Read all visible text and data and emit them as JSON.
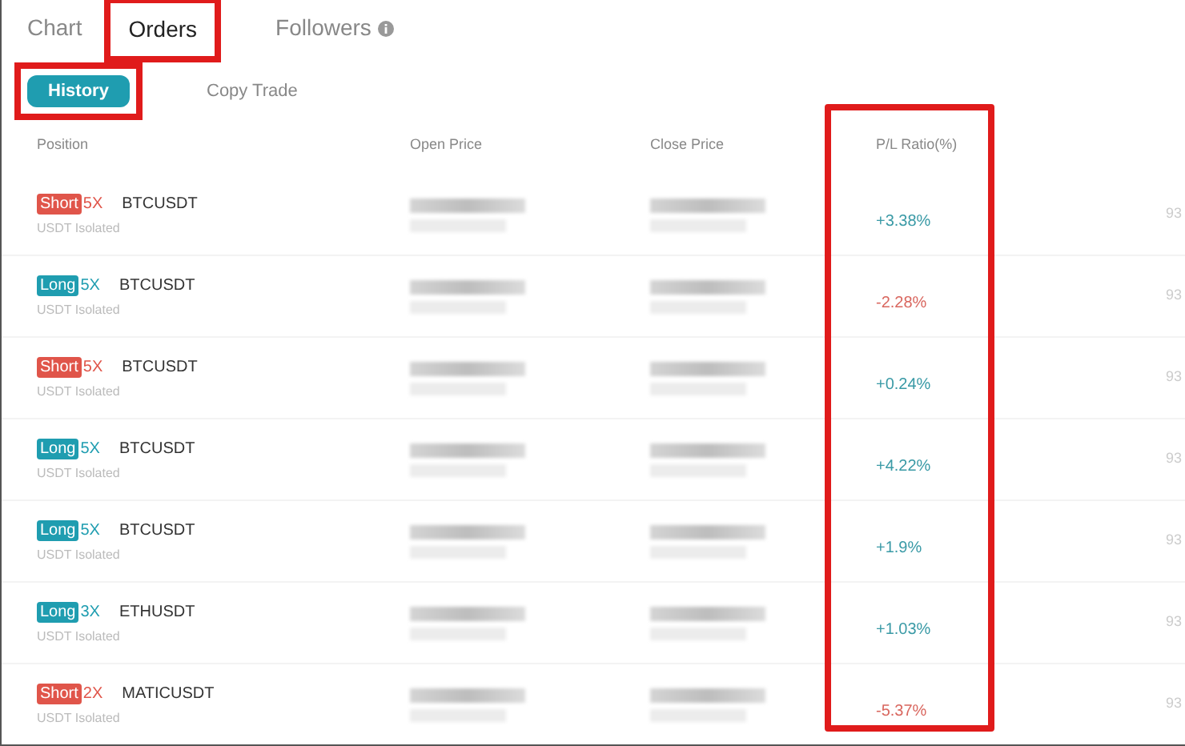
{
  "tabs": [
    {
      "label": "Chart",
      "selected": false,
      "highlighted": false,
      "info": false
    },
    {
      "label": "Orders",
      "selected": true,
      "highlighted": true,
      "info": false
    },
    {
      "label": "Followers",
      "selected": false,
      "highlighted": false,
      "info": true
    }
  ],
  "subtabs": [
    {
      "label": "History",
      "selected": true,
      "highlighted": true
    },
    {
      "label": "Copy Trade",
      "selected": false,
      "highlighted": false
    }
  ],
  "table": {
    "columns": [
      {
        "label": "Position",
        "highlighted": false
      },
      {
        "label": "Open Price",
        "highlighted": false
      },
      {
        "label": "Close Price",
        "highlighted": false
      },
      {
        "label": "P/L Ratio(%)",
        "highlighted": true
      }
    ],
    "rows": [
      {
        "kind": "short",
        "side_label": "Short",
        "leverage": "5X",
        "symbol": "BTCUSDT",
        "margin": "USDT Isolated",
        "pl_ratio": "+3.38%",
        "color": "#3a9aa6",
        "column_5": "93"
      },
      {
        "kind": "long",
        "side_label": "Long",
        "leverage": "5X",
        "symbol": "BTCUSDT",
        "margin": "USDT Isolated",
        "pl_ratio": "-2.28%",
        "color": "#d9675f",
        "column_5": "93"
      },
      {
        "kind": "short",
        "side_label": "Short",
        "leverage": "5X",
        "symbol": "BTCUSDT",
        "margin": "USDT Isolated",
        "pl_ratio": "+0.24%",
        "color": "#3a9aa6",
        "column_5": "93"
      },
      {
        "kind": "long",
        "side_label": "Long",
        "leverage": "5X",
        "symbol": "BTCUSDT",
        "margin": "USDT Isolated",
        "pl_ratio": "+4.22%",
        "color": "#3a9aa6",
        "column_5": "93"
      },
      {
        "kind": "long",
        "side_label": "Long",
        "leverage": "5X",
        "symbol": "BTCUSDT",
        "margin": "USDT Isolated",
        "pl_ratio": "+1.9%",
        "color": "#3a9aa6",
        "column_5": "93"
      },
      {
        "kind": "long",
        "side_label": "Long",
        "leverage": "3X",
        "symbol": "ETHUSDT",
        "margin": "USDT Isolated",
        "pl_ratio": "+1.03%",
        "color": "#3a9aa6",
        "column_5": "93"
      },
      {
        "kind": "short",
        "side_label": "Short",
        "leverage": "2X",
        "symbol": "MATICUSDT",
        "margin": "USDT Isolated",
        "pl_ratio": "-5.37%",
        "color": "#d9675f",
        "column_5": "93"
      }
    ]
  }
}
